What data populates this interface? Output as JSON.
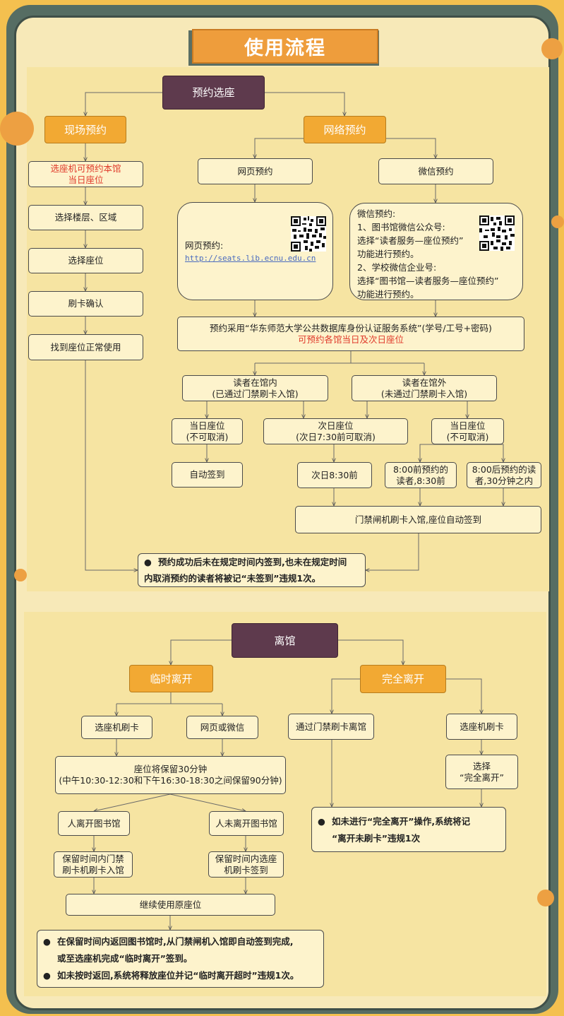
{
  "title": "使用流程",
  "colors": {
    "root": "#5e3a4d",
    "orange": "#f2a933",
    "red": "#e03b2b",
    "frame": "#566d63",
    "panel": "#f6e4a2"
  },
  "reserve": {
    "root": "预约选座",
    "onsite": {
      "label": "现场预约",
      "steps": [
        [
          "选座机可预约本馆",
          "当日座位"
        ],
        "选择楼层、区域",
        "选择座位",
        "刷卡确认",
        "找到座位正常使用"
      ]
    },
    "online": {
      "label": "网络预约",
      "web": {
        "label": "网页预约",
        "detail_label": "网页预约:",
        "url": "http://seats.lib.ecnu.edu.cn"
      },
      "wechat": {
        "label": "微信预约",
        "lines": [
          "微信预约:",
          "1、图书馆微信公众号:",
          "选择“读者服务—座位预约”",
          "功能进行预约。",
          "2、学校微信企业号:",
          "选择“图书馆—读者服务—座位预约”",
          "功能进行预约。"
        ]
      },
      "auth": {
        "line1": "预约采用“华东师范大学公共数据库身份认证服务系统”(学号/工号+密码)",
        "line2": "可预约各馆当日及次日座位"
      },
      "inside": {
        "line1": "读者在馆内",
        "line2": "(已通过门禁刷卡入馆)"
      },
      "outside": {
        "line1": "读者在馆外",
        "line2": "(未通过门禁刷卡入馆)"
      },
      "today_left": {
        "line1": "当日座位",
        "line2": "(不可取消)"
      },
      "next_day": {
        "line1": "次日座位",
        "line2": "(次日7:30前可取消)"
      },
      "today_right": {
        "line1": "当日座位",
        "line2": "(不可取消)"
      },
      "auto_signin": "自动签到",
      "next_830": "次日8:30前",
      "before_800": {
        "line1": "8:00前预约的",
        "line2": "读者,8:30前"
      },
      "after_800": {
        "line1": "8:00后预约的读",
        "line2": "者,30分钟之内"
      },
      "gate_signin": "门禁闸机刷卡入馆,座位自动签到"
    },
    "violation": {
      "bullet": "●",
      "line1": "预约成功后未在规定时间内签到,也未在规定时间",
      "line2": "内取消预约的读者将被记“未签到”违规1次。"
    }
  },
  "leave": {
    "root": "离馆",
    "temporary": {
      "label": "临时离开",
      "option_a": "选座机刷卡",
      "option_b": "网页或微信",
      "hold": {
        "line1": "座位将保留30分钟",
        "line2": "(中午10:30-12:30和下午16:30-18:30之间保留90分钟)"
      },
      "left_lib": "人离开图书馆",
      "stay_lib": "人未离开图书馆",
      "gate_in": {
        "line1": "保留时间内门禁",
        "line2": "刷卡机刷卡入馆"
      },
      "machine_in": {
        "line1": "保留时间内选座",
        "line2": "机刷卡签到"
      },
      "continue": "继续使用原座位",
      "notes": [
        {
          "bullet": "●",
          "line1": "在保留时间内返回图书馆时,从门禁闸机入馆即自动签到完成,",
          "line2": "或至选座机完成“临时离开”签到。"
        },
        {
          "bullet": "●",
          "line1": "如未按时返回,系统将释放座位并记“临时离开超时”违规1次。",
          "line2": ""
        }
      ]
    },
    "complete": {
      "label": "完全离开",
      "gate_out": "通过门禁刷卡离馆",
      "machine": "选座机刷卡",
      "select": {
        "line1": "选择",
        "line2": "“完全离开”"
      },
      "note": {
        "bullet": "●",
        "line1": "如未进行“完全离开”操作,系统将记",
        "line2": "“离开未刷卡”违规1次"
      }
    }
  },
  "icons": [
    "qr-code-icon"
  ]
}
